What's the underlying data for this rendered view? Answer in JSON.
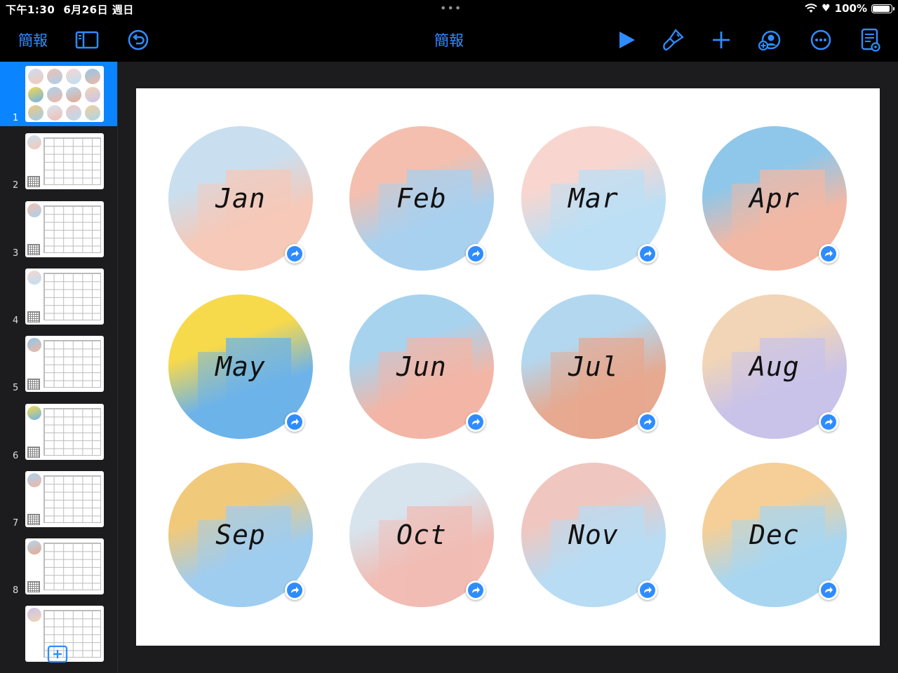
{
  "status": {
    "time": "下午1:30",
    "date": "6月26日 週日",
    "battery": "100%",
    "battery_level": 1.0
  },
  "toolbar": {
    "back_label": "簡報",
    "title": "簡報",
    "icons": [
      "sidebar-toggle-icon",
      "undo-icon",
      "play-icon",
      "paintbrush-icon",
      "plus-icon",
      "collaborate-icon",
      "more-icon",
      "document-settings-icon"
    ]
  },
  "sidebar": {
    "slides": [
      {
        "number": "1"
      },
      {
        "number": "2"
      },
      {
        "number": "3"
      },
      {
        "number": "4"
      },
      {
        "number": "5"
      },
      {
        "number": "6"
      },
      {
        "number": "7"
      },
      {
        "number": "8"
      }
    ]
  },
  "slide": {
    "months": [
      {
        "label": "Jan",
        "colors": [
          "#f6c9b8",
          "#c9dff0"
        ]
      },
      {
        "label": "Feb",
        "colors": [
          "#a9d1ef",
          "#f4bfae"
        ]
      },
      {
        "label": "Mar",
        "colors": [
          "#bcdff5",
          "#f8d6cf"
        ]
      },
      {
        "label": "Apr",
        "colors": [
          "#f2b8a4",
          "#8fc7ea"
        ]
      },
      {
        "label": "May",
        "colors": [
          "#6db3ea",
          "#f7d94c"
        ]
      },
      {
        "label": "Jun",
        "colors": [
          "#f3b6a6",
          "#a7d3ef"
        ]
      },
      {
        "label": "Jul",
        "colors": [
          "#e7a98f",
          "#b3d7ef"
        ]
      },
      {
        "label": "Aug",
        "colors": [
          "#c9c3ea",
          "#f1d5b6"
        ]
      },
      {
        "label": "Sep",
        "colors": [
          "#9fcdf0",
          "#f1c97a"
        ]
      },
      {
        "label": "Oct",
        "colors": [
          "#f1bdb4",
          "#d7e4ee"
        ]
      },
      {
        "label": "Nov",
        "colors": [
          "#b7dcf4",
          "#efc7c0"
        ]
      },
      {
        "label": "Dec",
        "colors": [
          "#a8d6f1",
          "#f5cf97"
        ]
      }
    ]
  }
}
